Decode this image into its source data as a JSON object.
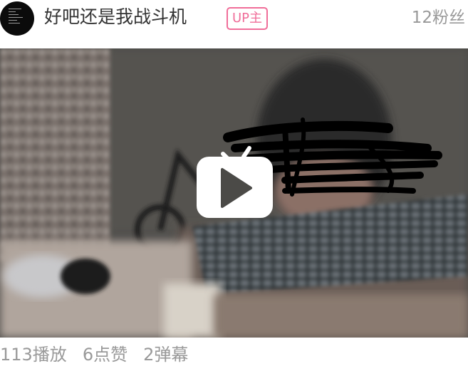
{
  "uploader": {
    "name": "好吧还是我战斗机",
    "badge": "UP主",
    "fans": "12粉丝"
  },
  "video": {
    "play_icon": "bilibili-tv-play-icon",
    "thumbnail_subject": "webcam still with scribbled-out face"
  },
  "stats": {
    "plays": "113播放",
    "likes": "6点赞",
    "danmaku": "2弹幕"
  },
  "colors": {
    "badge_pink": "#f06d99",
    "muted_text": "#999999",
    "name_text": "#333333"
  }
}
